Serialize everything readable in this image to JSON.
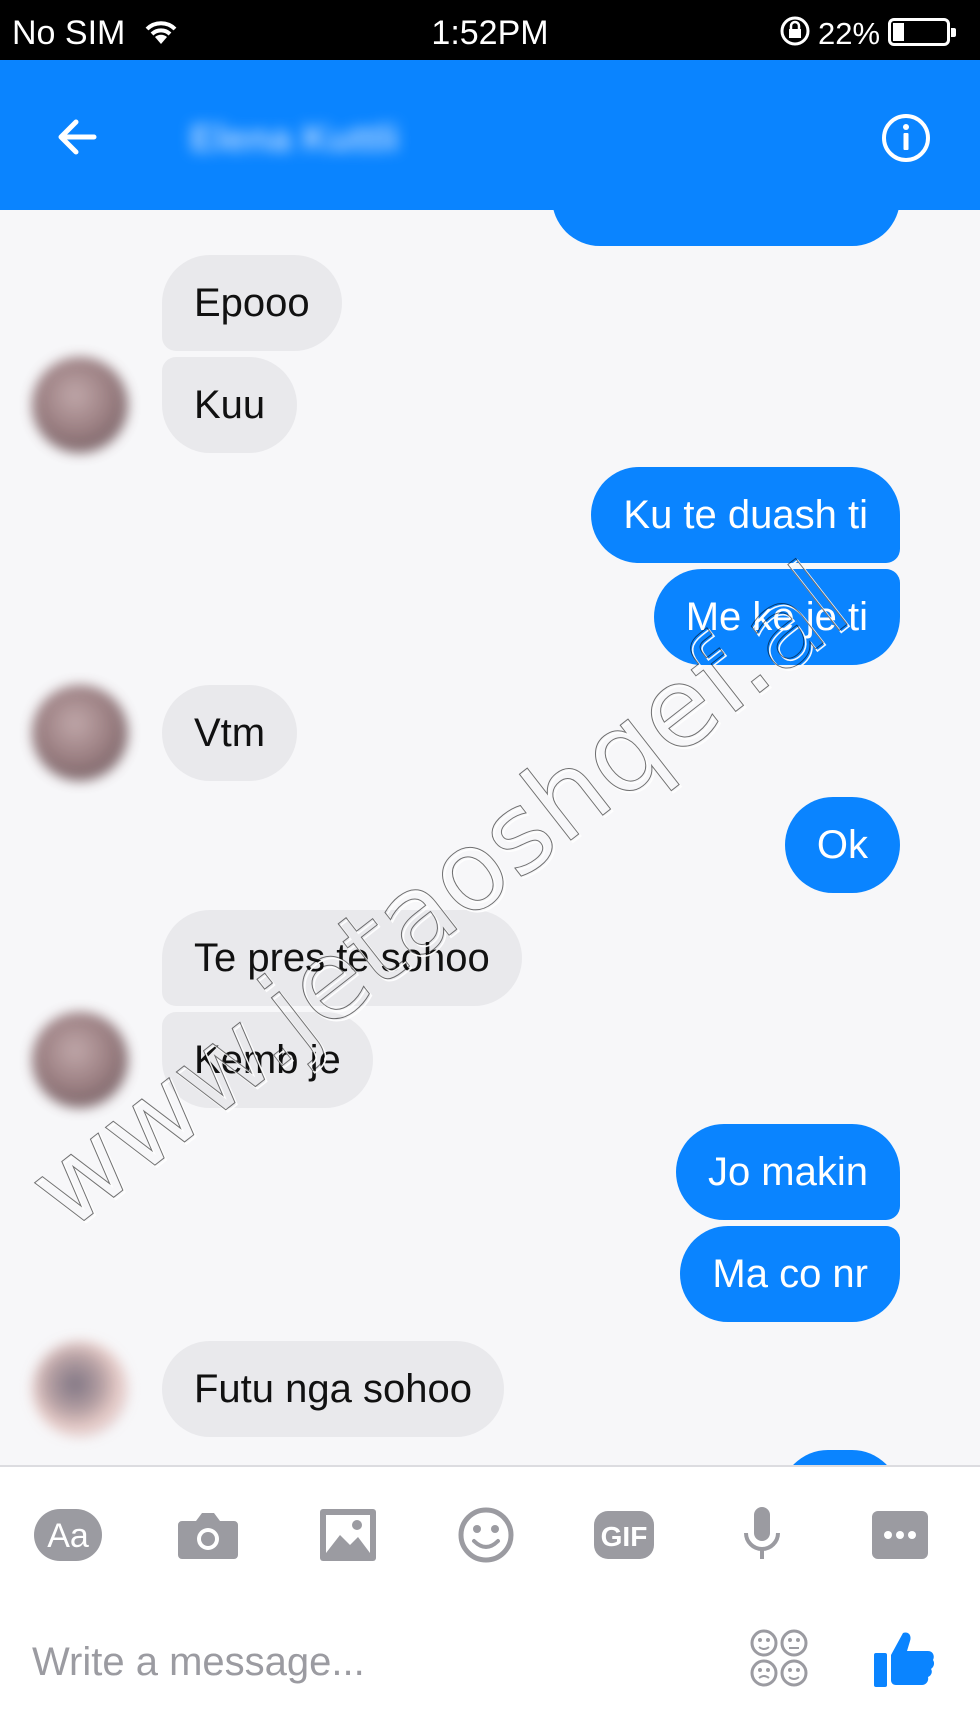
{
  "status_bar": {
    "carrier": "No SIM",
    "time": "1:52PM",
    "battery": "22%",
    "battery_level": 0.22
  },
  "header": {
    "contact_name": "Elena Kuttli",
    "back_icon": "arrow-left-icon",
    "info_icon": "info-icon"
  },
  "messages": [
    {
      "from": "contact",
      "text": "Epooo"
    },
    {
      "from": "contact",
      "text": "Kuu"
    },
    {
      "from": "me",
      "text": "Ku te duash ti"
    },
    {
      "from": "me",
      "text": "Me ke je ti"
    },
    {
      "from": "contact",
      "text": "Vtm"
    },
    {
      "from": "me",
      "text": "Ok"
    },
    {
      "from": "contact",
      "text": "Te pres te sohoo"
    },
    {
      "from": "contact",
      "text": "Kemb je"
    },
    {
      "from": "me",
      "text": "Jo makin"
    },
    {
      "from": "me",
      "text": "Ma co nr"
    },
    {
      "from": "contact",
      "text": "Futu nga sohoo"
    }
  ],
  "watermark": "www.jetaoshqef.al",
  "composer": {
    "placeholder": "Write a message...",
    "text_button": "Aa",
    "gif_button": "GIF",
    "toolbar_icons": [
      "text-format-icon",
      "camera-icon",
      "image-icon",
      "emoji-icon",
      "gif-icon",
      "microphone-icon",
      "more-icon"
    ],
    "emoji_picker_icon": "emoji-grid-icon",
    "like_icon": "thumbs-up-icon"
  },
  "colors": {
    "accent": "#0a84ff",
    "incoming_bubble": "#e9e9ec",
    "composer_icon": "#9b9ba1"
  }
}
